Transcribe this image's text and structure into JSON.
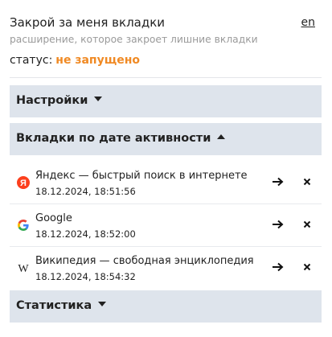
{
  "header": {
    "title": "Закрой за меня вкладки",
    "lang_link": "en",
    "subtitle": "расширение, которое закроет лишние вкладки",
    "status_label": "статус:",
    "status_value": "не запущено",
    "status_color": "#f08a24"
  },
  "sections": {
    "settings": {
      "label": "Настройки",
      "state": "collapsed"
    },
    "tabs": {
      "label": "Вкладки по дате активности",
      "state": "expanded"
    },
    "stats": {
      "label": "Статистика",
      "state": "collapsed"
    }
  },
  "tabs": [
    {
      "title": "Яндекс — быстрый поиск в интернете",
      "date": "18.12.2024, 18:51:56",
      "icon": "yandex-icon"
    },
    {
      "title": "Google",
      "date": "18.12.2024, 18:52:00",
      "icon": "google-icon"
    },
    {
      "title": "Википедия — свободная энциклопедия",
      "date": "18.12.2024, 18:54:32",
      "icon": "wikipedia-icon"
    }
  ],
  "colors": {
    "section_bg": "#dee4ec",
    "status_orange": "#f08a24",
    "yandex_red": "#fc3f1d"
  }
}
